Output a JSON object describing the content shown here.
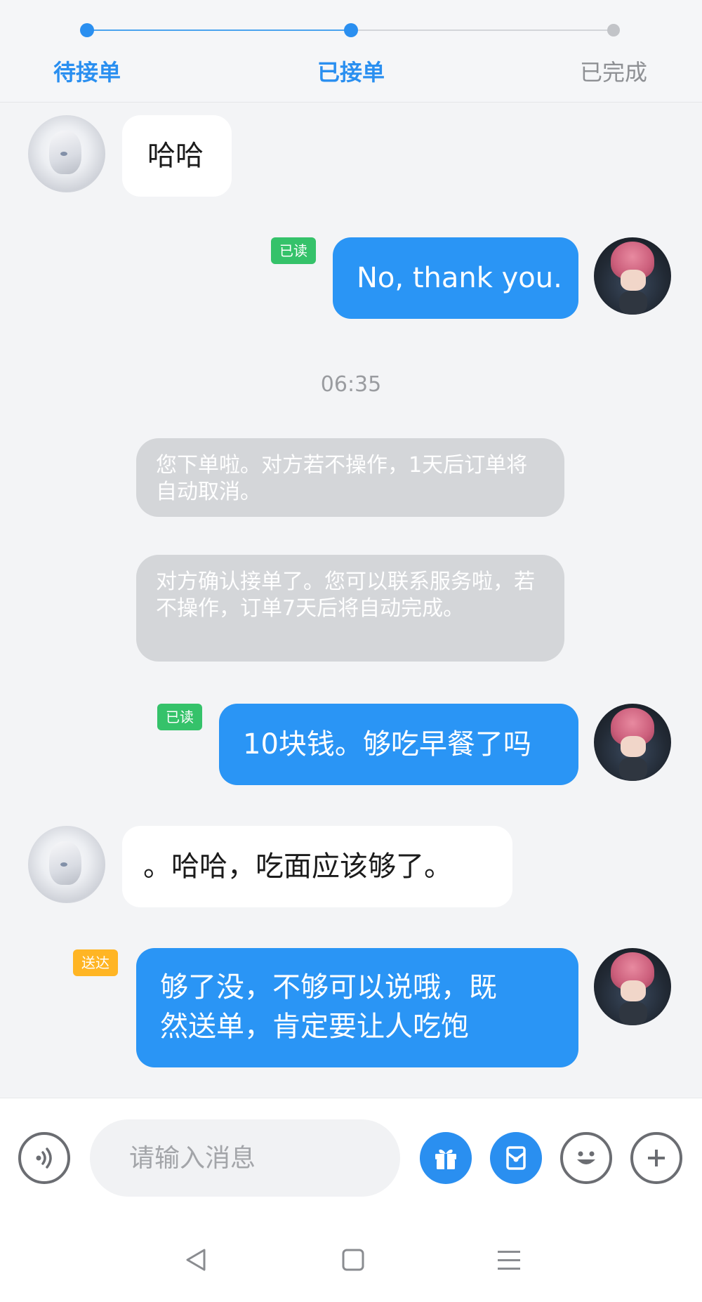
{
  "progress": {
    "steps": [
      {
        "label": "待接单",
        "state": "active"
      },
      {
        "label": "已接单",
        "state": "active"
      },
      {
        "label": "已完成",
        "state": "pending"
      }
    ]
  },
  "messages": [
    {
      "type": "in",
      "text": "哈哈"
    },
    {
      "type": "out",
      "text": "No, thank you.",
      "status": "已读"
    },
    {
      "type": "time",
      "text": "06:35"
    },
    {
      "type": "system",
      "text": "您下单啦。对方若不操作，1天后订单将自动取消。"
    },
    {
      "type": "system",
      "text": "对方确认接单了。您可以联系服务啦，若不操作，订单7天后将自动完成。"
    },
    {
      "type": "out",
      "text": "10块钱。够吃早餐了吗",
      "status": "已读"
    },
    {
      "type": "in",
      "text": "。哈哈，吃面应该够了。"
    },
    {
      "type": "out",
      "lines": [
        "够了没，不够可以说哦，既",
        "然送单，肯定要让人吃饱"
      ],
      "status": "送达"
    }
  ],
  "input": {
    "placeholder": "请输入消息"
  },
  "icons": {
    "voice": "voice-icon",
    "gift": "gift-icon",
    "red_packet": "red-packet-icon",
    "emoji": "emoji-icon",
    "more": "plus-icon",
    "nav_back": "back-triangle-icon",
    "nav_home": "home-square-icon",
    "nav_menu": "menu-lines-icon"
  },
  "colors": {
    "accent": "#2a8ff0",
    "out_bubble": "#2a95f5",
    "read_tag": "#35c26a",
    "sent_tag": "#ffb524",
    "system_bubble": "#d4d6d9"
  }
}
